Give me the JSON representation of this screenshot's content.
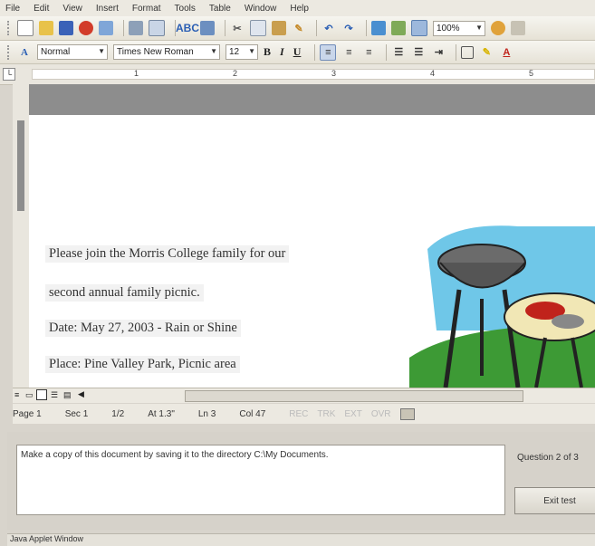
{
  "menu": [
    "File",
    "Edit",
    "View",
    "Insert",
    "Format",
    "Tools",
    "Table",
    "Window",
    "Help"
  ],
  "toolbar": {
    "zoom": "100%",
    "style": "Normal",
    "font": "Times New Roman",
    "size": "12",
    "bold_label": "B",
    "italic_label": "I",
    "underline_label": "U"
  },
  "ruler": {
    "marks": [
      "1",
      "2",
      "3",
      "4",
      "5"
    ]
  },
  "document": {
    "lines": [
      "Please join the Morris College family for our",
      "second annual family picnic.",
      "Date:  May 27, 2003 - Rain or Shine",
      "Place:  Pine Valley Park, Picnic area"
    ]
  },
  "status": {
    "page": "Page 1",
    "sec": "Sec 1",
    "pages": "1/2",
    "at": "At 1.3\"",
    "ln": "Ln 3",
    "col": "Col 47",
    "rec": "REC",
    "trk": "TRK",
    "ext": "EXT",
    "ovr": "OVR"
  },
  "question": {
    "text": "Make a copy of this document by saving it to the directory C:\\My Documents.",
    "number": "Question 2 of 3",
    "exit_label": "Exit test"
  },
  "footer": "Java Applet Window",
  "colors": {
    "accent": "#2b5fb4",
    "sky": "#6fc7e8",
    "grass": "#3d9a35"
  }
}
